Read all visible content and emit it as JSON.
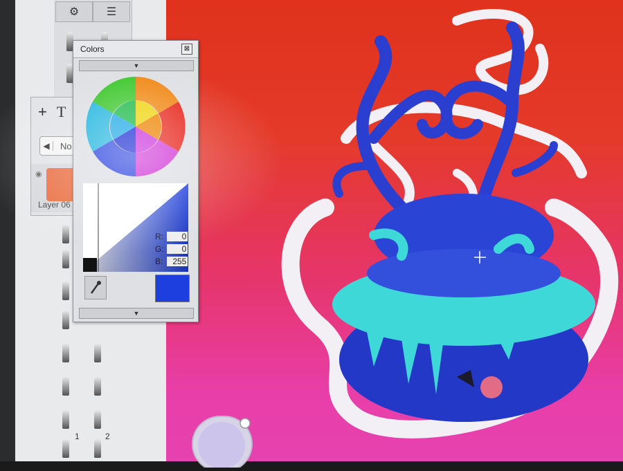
{
  "tools_panel": {
    "top_icons": [
      "sliders-icon",
      "stack-icon"
    ],
    "layer_toolbar": {
      "add_symbol": "+",
      "text_symbol": "T"
    },
    "blend_mode_value": "No",
    "layer_name": "Layer 06",
    "brush_numbers": [
      "1",
      "2"
    ]
  },
  "colors_panel": {
    "title": "Colors",
    "close_symbol": "⊠",
    "rgb": {
      "r_label": "R:",
      "r_value": "0",
      "g_label": "G:",
      "g_value": "0",
      "b_label": "B:",
      "b_value": "255"
    },
    "current_color": "#1e3fe0"
  },
  "colors": {
    "canvas_red": "#e0321c",
    "canvas_pink": "#e642b0",
    "creature_blue": "#2a45d6",
    "creature_cyan": "#3fd8d8",
    "smoke_white": "#f2f0f4"
  }
}
